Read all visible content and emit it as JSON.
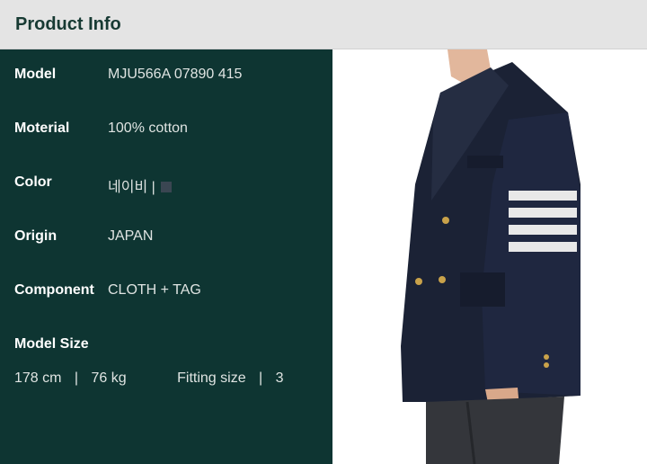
{
  "header": {
    "title": "Product Info"
  },
  "details": [
    {
      "label": "Model",
      "value": "MJU566A 07890 415"
    },
    {
      "label": "Moterial",
      "value": "100% cotton"
    },
    {
      "label": "Color",
      "value": "네이비 |"
    },
    {
      "label": "Origin",
      "value": "JAPAN"
    },
    {
      "label": "Component",
      "value": "CLOTH + TAG"
    }
  ],
  "model_size": {
    "label": "Model Size",
    "height": "178 cm",
    "weight": "76 kg",
    "fitting_label": "Fitting size",
    "fitting_value": "3",
    "separator": "|"
  },
  "colors": {
    "header_bg": "#e4e4e4",
    "panel_bg": "#0e3532",
    "swatch": "#3a4652",
    "jacket": "#1b2235"
  }
}
